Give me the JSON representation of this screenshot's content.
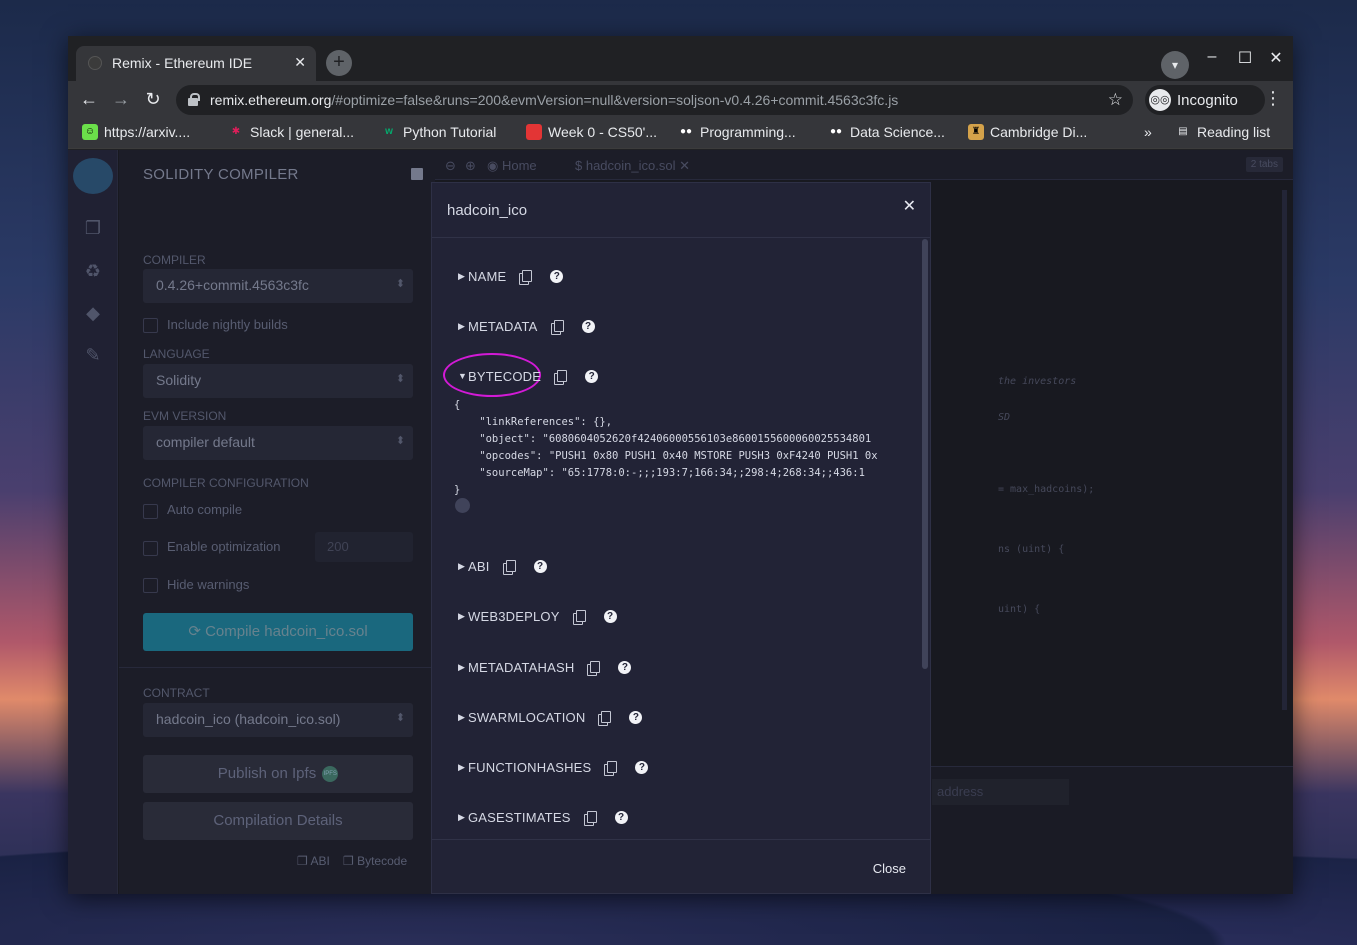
{
  "browser": {
    "tab_title": "Remix - Ethereum IDE",
    "url_host": "remix.ethereum.org",
    "url_rest": "/#optimize=false&runs=200&evmVersion=null&version=soljson-v0.4.26+commit.4563c3fc.js",
    "incognito_label": "Incognito",
    "bookmarks": [
      {
        "label": "https://arxiv....",
        "icon": "arxiv-smiley-icon",
        "color": "#6be04a"
      },
      {
        "label": "Slack | general...",
        "icon": "slack-icon",
        "color": "#e01e5a"
      },
      {
        "label": "Python Tutorial",
        "icon": "w3schools-icon",
        "color": "#04aa6d"
      },
      {
        "label": "Week 0 - CS50'...",
        "icon": "cs50-icon",
        "color": "#e33535"
      },
      {
        "label": "Programming...",
        "icon": "medium-icon",
        "color": "#ffffff"
      },
      {
        "label": "Data Science...",
        "icon": "medium-icon",
        "color": "#ffffff"
      },
      {
        "label": "Cambridge Di...",
        "icon": "cambridge-icon",
        "color": "#d4a24a"
      }
    ],
    "more_bookmarks": "»",
    "reading_list": "Reading list"
  },
  "sidepanel": {
    "title": "SOLIDITY COMPILER",
    "compiler_label": "COMPILER",
    "compiler_value": "0.4.26+commit.4563c3fc",
    "nightly_label": "Include nightly builds",
    "language_label": "LANGUAGE",
    "language_value": "Solidity",
    "evm_label": "EVM VERSION",
    "evm_value": "compiler default",
    "config_label": "COMPILER CONFIGURATION",
    "auto_compile": "Auto compile",
    "enable_opt": "Enable optimization",
    "runs_value": "200",
    "hide_warnings": "Hide warnings",
    "compile_button": "Compile hadcoin_ico.sol",
    "contract_label": "CONTRACT",
    "contract_value": "hadcoin_ico (hadcoin_ico.sol)",
    "publish_button": "Publish on Ipfs",
    "ipfs_badge": "IPFS",
    "details_button": "Compilation Details",
    "abi_link": "ABI",
    "bytecode_link": "Bytecode"
  },
  "editor": {
    "home_tab": "Home",
    "file_tab": "hadcoin_ico.sol",
    "tabs_badge": "2 tabs",
    "code_fragments": [
      "the investors",
      "SD",
      "= max_hadcoins);",
      "ns (uint) {",
      "uint) {",
      "{"
    ],
    "address_placeholder": "address"
  },
  "modal": {
    "title": "hadcoin_ico",
    "close_button": "Close",
    "sections": {
      "name": "NAME",
      "metadata": "METADATA",
      "bytecode": "BYTECODE",
      "abi": "ABI",
      "web3deploy": "WEB3DEPLOY",
      "metadatahash": "METADATAHASH",
      "swarmlocation": "SWARMLOCATION",
      "functionhashes": "FUNCTIONHASHES",
      "gasestimates": "GASESTIMATES"
    },
    "bytecode_json": "{\n    \"linkReferences\": {},\n    \"object\": \"6080604052620f42406000556103e8600155600060025534801\n    \"opcodes\": \"PUSH1 0x80 PUSH1 0x40 MSTORE PUSH3 0xF4240 PUSH1 0x\n    \"sourceMap\": \"65:1778:0:-;;;193:7;166:34;;298:4;268:34;;436:1\n}",
    "highlight_color": "#d21ad6"
  }
}
